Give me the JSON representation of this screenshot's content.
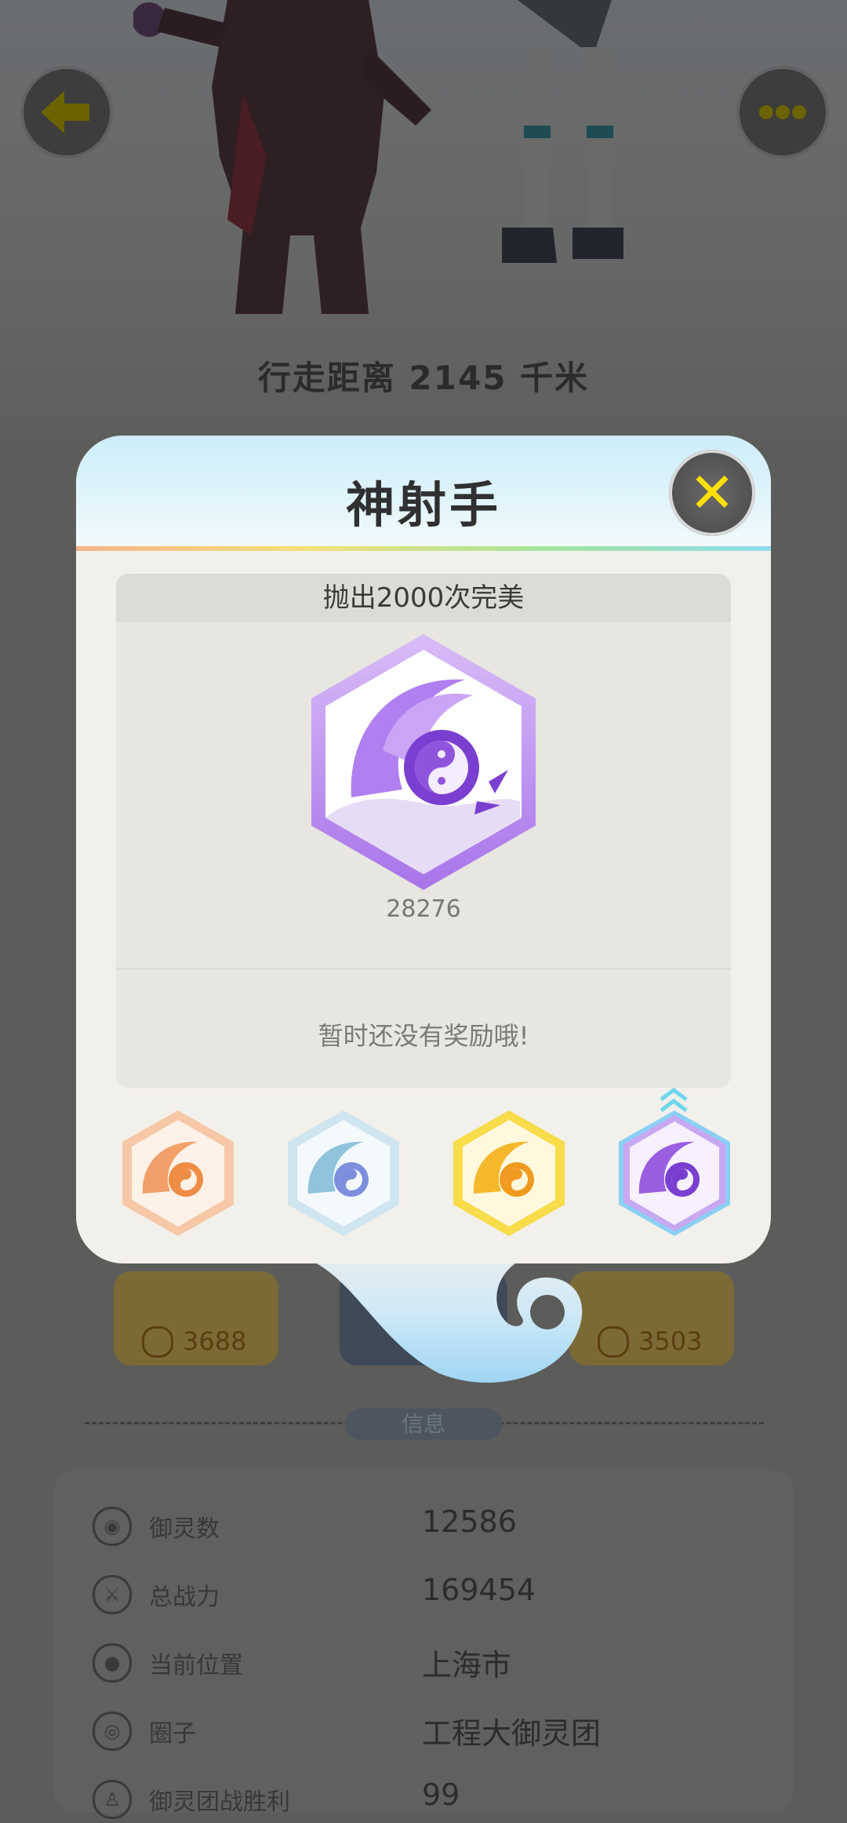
{
  "profile": {
    "walk_distance": "行走距离 2145 千米",
    "card_left_value": "3688",
    "card_right_value": "3503",
    "section_label": "信息"
  },
  "info": [
    {
      "icon": "spirit-icon",
      "label": "御灵数",
      "value": "12586"
    },
    {
      "icon": "sword-icon",
      "label": "总战力",
      "value": "169454"
    },
    {
      "icon": "location-pin-icon",
      "label": "当前位置",
      "value": "上海市"
    },
    {
      "icon": "target-circle-icon",
      "label": "圈子",
      "value": "工程大御灵团"
    },
    {
      "icon": "figure-icon",
      "label": "御灵团战胜利",
      "value": "99"
    }
  ],
  "modal": {
    "title": "神射手",
    "condition": "抛出2000次完美",
    "count": "28276",
    "reward_text": "暂时还没有奖励哦!",
    "close_label": "✕"
  },
  "tiers": [
    {
      "name": "bronze",
      "color": "#f2a06a",
      "accent": "#f5c7a8"
    },
    {
      "name": "silver",
      "color": "#8fc4dc",
      "accent": "#d4e9f3"
    },
    {
      "name": "gold",
      "color": "#f5c22a",
      "accent": "#fbe38a"
    },
    {
      "name": "purple",
      "color": "#9a5ee0",
      "accent": "#c9a8f2",
      "current": true
    }
  ],
  "colors": {
    "accent_yellow": "#ffe000",
    "badge_purple": "#9a5ee0"
  }
}
